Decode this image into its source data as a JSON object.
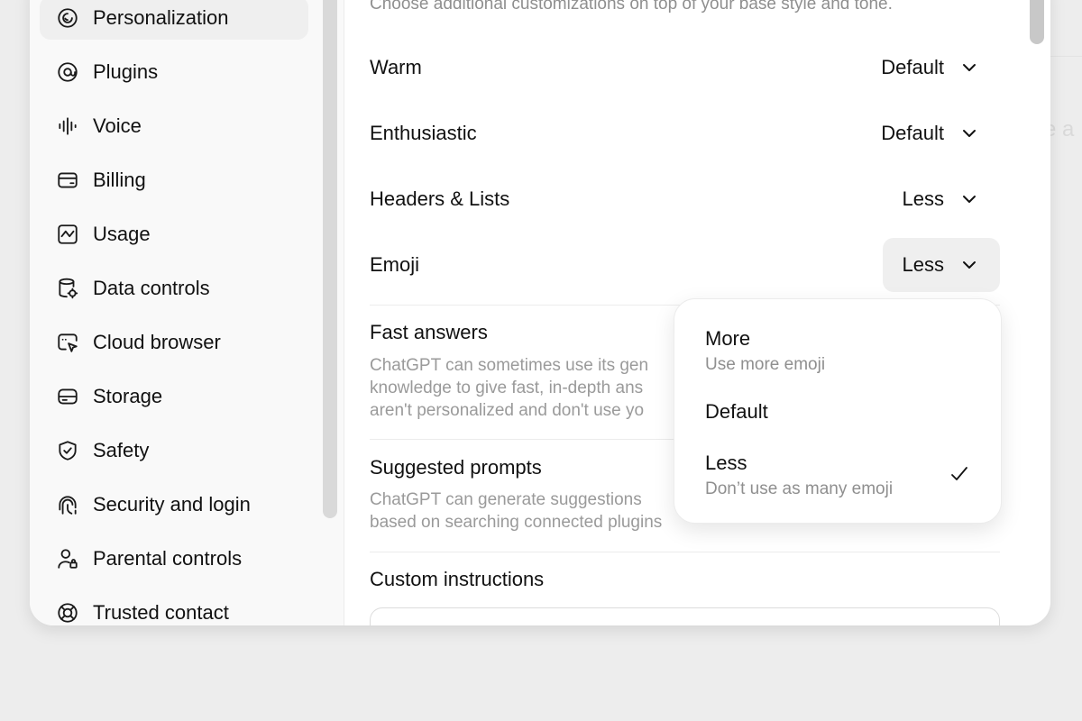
{
  "background": {
    "partial_text": "re a"
  },
  "sidebar": {
    "items": [
      {
        "label": "Personalization",
        "icon": "personalization-icon",
        "active": true
      },
      {
        "label": "Plugins",
        "icon": "plugins-icon"
      },
      {
        "label": "Voice",
        "icon": "voice-waveform-icon"
      },
      {
        "label": "Billing",
        "icon": "billing-card-icon"
      },
      {
        "label": "Usage",
        "icon": "usage-chart-icon"
      },
      {
        "label": "Data controls",
        "icon": "data-controls-icon"
      },
      {
        "label": "Cloud browser",
        "icon": "cloud-browser-icon"
      },
      {
        "label": "Storage",
        "icon": "storage-icon"
      },
      {
        "label": "Safety",
        "icon": "shield-check-icon"
      },
      {
        "label": "Security and login",
        "icon": "security-icon"
      },
      {
        "label": "Parental controls",
        "icon": "parental-controls-icon"
      },
      {
        "label": "Trusted contact",
        "icon": "trusted-contact-icon"
      }
    ]
  },
  "main": {
    "subtitle": "Choose additional customizations on top of your base style and tone.",
    "settings": [
      {
        "label": "Warm",
        "value": "Default"
      },
      {
        "label": "Enthusiastic",
        "value": "Default"
      },
      {
        "label": "Headers & Lists",
        "value": "Less"
      },
      {
        "label": "Emoji",
        "value": "Less"
      }
    ],
    "fast_answers": {
      "title": "Fast answers",
      "description_lines": [
        "ChatGPT can sometimes use its gen",
        "knowledge to give fast, in-depth ans",
        "aren't personalized and don't use yo"
      ]
    },
    "suggested_prompts": {
      "title": "Suggested prompts",
      "description_lines": [
        "ChatGPT can generate suggestions",
        "based on searching connected plugins"
      ]
    },
    "custom_instructions": {
      "title": "Custom instructions"
    }
  },
  "emoji_dropdown": {
    "options": [
      {
        "title": "More",
        "subtitle": "Use more emoji",
        "selected": false
      },
      {
        "title": "Default",
        "subtitle": "",
        "selected": false
      },
      {
        "title": "Less",
        "subtitle": "Don’t use as many emoji",
        "selected": true
      }
    ]
  }
}
